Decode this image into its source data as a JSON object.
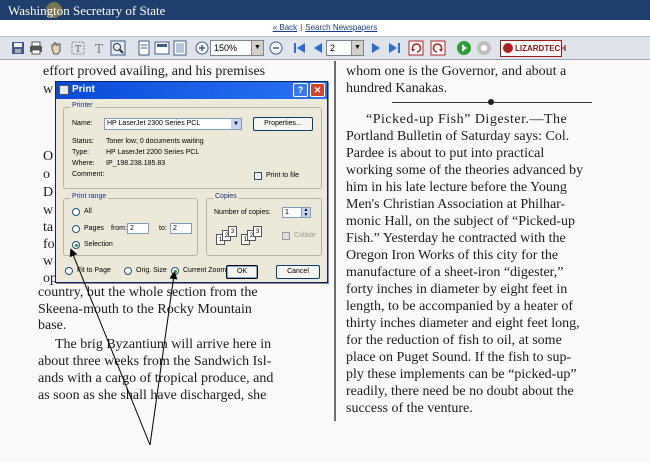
{
  "header": {
    "title": "Washington Secretary of State"
  },
  "nav": {
    "back": "« Back",
    "separator": "|",
    "search": "Search Newspapers"
  },
  "toolbar": {
    "zoom_value": "150%",
    "page_value": "2",
    "brand": "LIZARDTECH",
    "icons": [
      "save-icon",
      "print-icon",
      "hand-icon",
      "text-select-icon",
      "text-icon",
      "zoom-rect-icon",
      "single-page-icon",
      "fit-width-icon",
      "fit-page-icon",
      "zoom-in-icon",
      "zoom-out-icon",
      "first-page-icon",
      "prev-page-icon",
      "next-page-icon",
      "last-page-icon",
      "rotate-left-icon",
      "rotate-right-icon",
      "go-icon",
      "stop-icon"
    ]
  },
  "newspaper": {
    "left_lines": [
      "effort proved availing, and his premises",
      "country, but the whole section from the",
      "Skeena-mouth to the Rocky Mountain",
      "base.",
      "The brig Byzantium will arrive here in",
      "about three weeks from the Sandwich Isl-",
      "ands with a cargo of tropical produce, and",
      "as soon as she shall have discharged, she"
    ],
    "left_fragments": [
      "w",
      "O",
      "o",
      "D",
      "w",
      "ta",
      "for",
      "w",
      "op"
    ],
    "right_lines": [
      "whom one is the Governor, and about a",
      "hundred Kanakas.",
      "“Picked-up Fish” Digester.—The",
      "Portland Bulletin of Saturday says: Col.",
      "Pardee is about to put into practical",
      "working some of the theories advanced by",
      "him in his late lecture before the Young",
      "Men's Christian Association at Philhar-",
      "monic Hall, on the subject of “Picked-up",
      "Fish.” Yesterday he contracted with the",
      "Oregon Iron Works of this city for the",
      "manufacture of a sheet-iron “digester,”",
      "forty inches in diameter by eight feet in",
      "length, to be accompanied by a heater of",
      "thirty inches diameter and eight feet long,",
      "for the reduction of fish to oil, at some",
      "place on Puget Sound. If the fish to sup-",
      "ply these implements can be “picked-up”",
      "readily, there need be no doubt about the",
      "success of the venture."
    ]
  },
  "dialog": {
    "title": "Print",
    "help": "?",
    "close": "✕",
    "printer_group": "Printer",
    "name_label": "Name:",
    "name_value": "HP LaserJet 2300 Series PCL",
    "properties": "Properties...",
    "status_label": "Status:",
    "status_value": "Toner low; 0 documents waiting",
    "type_label": "Type:",
    "type_value": "HP LaserJet 2200 Series PCL",
    "where_label": "Where:",
    "where_value": "IP_198.238.185.83",
    "comment_label": "Comment:",
    "print_to_file": "Print to file",
    "range_group": "Print range",
    "all": "All",
    "pages": "Pages",
    "from_label": "from:",
    "from_value": "2",
    "to_label": "to:",
    "to_value": "2",
    "selection": "Selection",
    "copies_group": "Copies",
    "copies_label": "Number of copies:",
    "copies_value": "1",
    "collate": "Collate",
    "fit_to_page": "Fit to Page",
    "orig_size": "Orig. Size",
    "current_zoom": "Current Zoom",
    "ok": "OK",
    "cancel": "Cancel"
  }
}
